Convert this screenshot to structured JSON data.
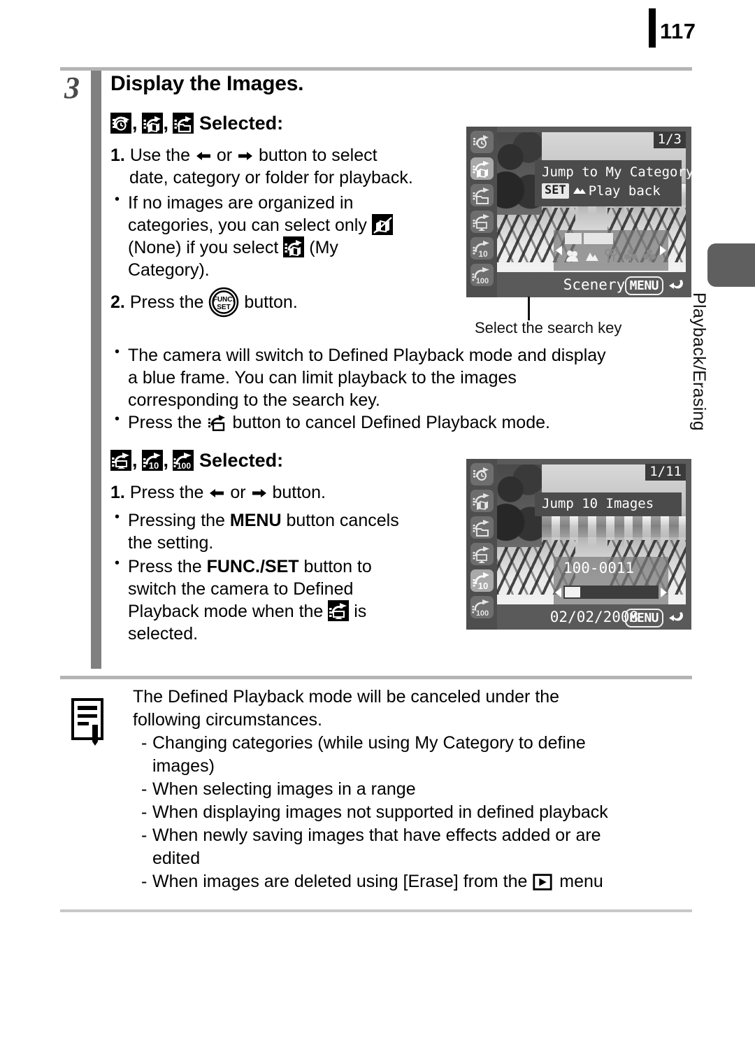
{
  "page": {
    "number": "117",
    "side_tab_label": "Playback/Erasing"
  },
  "step": {
    "number": "3",
    "title": "Display the Images."
  },
  "section_a": {
    "icons": [
      "jump-date-icon",
      "jump-my-category-icon",
      "jump-folder-icon"
    ],
    "heading_suffix": "Selected:",
    "comma": ",",
    "steps": [
      {
        "num": "1.",
        "line1_before": "Use the",
        "line1_middle": "or",
        "line1_after": "button to select",
        "line2": "date, category or folder for playback."
      },
      {
        "num": "2.",
        "before": "Press the",
        "after": "button."
      }
    ],
    "bullets": [
      {
        "part1": "If no images are organized in",
        "part2": "categories, you can select only",
        "part3": "(None) if you select",
        "part4": "(My",
        "part5": "Category)."
      }
    ],
    "bullets_wide": [
      {
        "line1": "The camera will switch to Defined Playback mode and display",
        "line2": "a blue frame. You can limit playback to the images",
        "line3": "corresponding to the search key."
      },
      {
        "before": "Press the",
        "after": "button to cancel Defined Playback mode."
      }
    ]
  },
  "section_b": {
    "icons": [
      "jump-movie-icon",
      "jump-10-icon",
      "jump-100-icon"
    ],
    "heading_suffix": "Selected:",
    "comma": ",",
    "step1": {
      "num": "1.",
      "before": "Press the",
      "middle": "or",
      "after": "button."
    },
    "bullets": [
      {
        "before": "Pressing the",
        "bold": "MENU",
        "after": "button cancels",
        "line2": "the setting."
      },
      {
        "before": "Press the",
        "bold": "FUNC./SET",
        "after": "button to",
        "line2": "switch the camera to Defined",
        "line3_before": "Playback mode when the",
        "line3_after": "is",
        "line4": "selected."
      }
    ]
  },
  "callout": {
    "label": "Select the search key"
  },
  "lcd_1": {
    "counter": "1/3",
    "banner_title": "Jump to My Category",
    "set_badge": "SET",
    "set_action": "Play back",
    "bottom_label": "Scenery",
    "menu_badge": "MENU",
    "sidebar_icons": [
      "jump-date-icon",
      "jump-my-category-icon",
      "jump-folder-icon",
      "jump-movie-icon",
      "jump-10-icon",
      "jump-100-icon"
    ],
    "selected_sidebar_index": 1,
    "category_icons": [
      "people-icon",
      "scenery-icon",
      "events-icon",
      "category-1-icon",
      "category-2-icon"
    ],
    "selected_category_index": 1
  },
  "lcd_2": {
    "counter": "1/11",
    "banner_title": "Jump 10 Images",
    "file_number": "100-0011",
    "bottom_label": "02/02/2008",
    "menu_badge": "MENU",
    "sidebar_icons": [
      "jump-date-icon",
      "jump-my-category-icon",
      "jump-folder-icon",
      "jump-movie-icon",
      "jump-10-icon",
      "jump-100-icon"
    ],
    "selected_sidebar_index": 4
  },
  "note": {
    "lead_line1": "The Defined Playback mode will be canceled under the",
    "lead_line2": "following circumstances.",
    "items": [
      {
        "line1": "Changing categories (while using My Category to define",
        "line2": "images)"
      },
      {
        "line1": "When selecting images in a range"
      },
      {
        "line1": "When displaying images not supported in defined playback"
      },
      {
        "line1": "When newly saving images that have effects added or are",
        "line2": "edited"
      },
      {
        "line1_before": "When images are deleted using [Erase] from the",
        "line1_after": "menu"
      }
    ]
  },
  "colors": {
    "spine_gray": "#808080",
    "rule_gray": "#b4b4b4",
    "tab_gray": "#5f5f5f",
    "lcd_bg": "#5a5a5a"
  }
}
